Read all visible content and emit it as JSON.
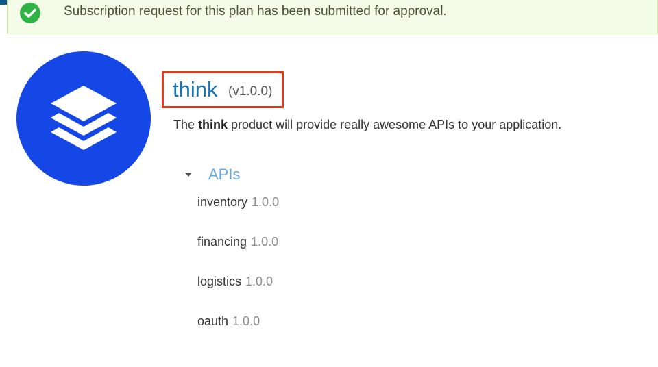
{
  "alert": {
    "icon": "check-circle-icon",
    "message": "Subscription request for this plan has been submitted for approval.",
    "color": "#2fb344"
  },
  "product": {
    "logo_icon": "layers-icon",
    "logo_color": "#1447e6",
    "name": "think",
    "version": "(v1.0.0)",
    "description_prefix": "The ",
    "description_bold": "think",
    "description_suffix": " product will provide really awesome APIs to your application."
  },
  "apis": {
    "label": "APIs",
    "items": [
      {
        "name": "inventory",
        "version": "1.0.0"
      },
      {
        "name": "financing",
        "version": "1.0.0"
      },
      {
        "name": "logistics",
        "version": "1.0.0"
      },
      {
        "name": "oauth",
        "version": "1.0.0"
      }
    ]
  }
}
